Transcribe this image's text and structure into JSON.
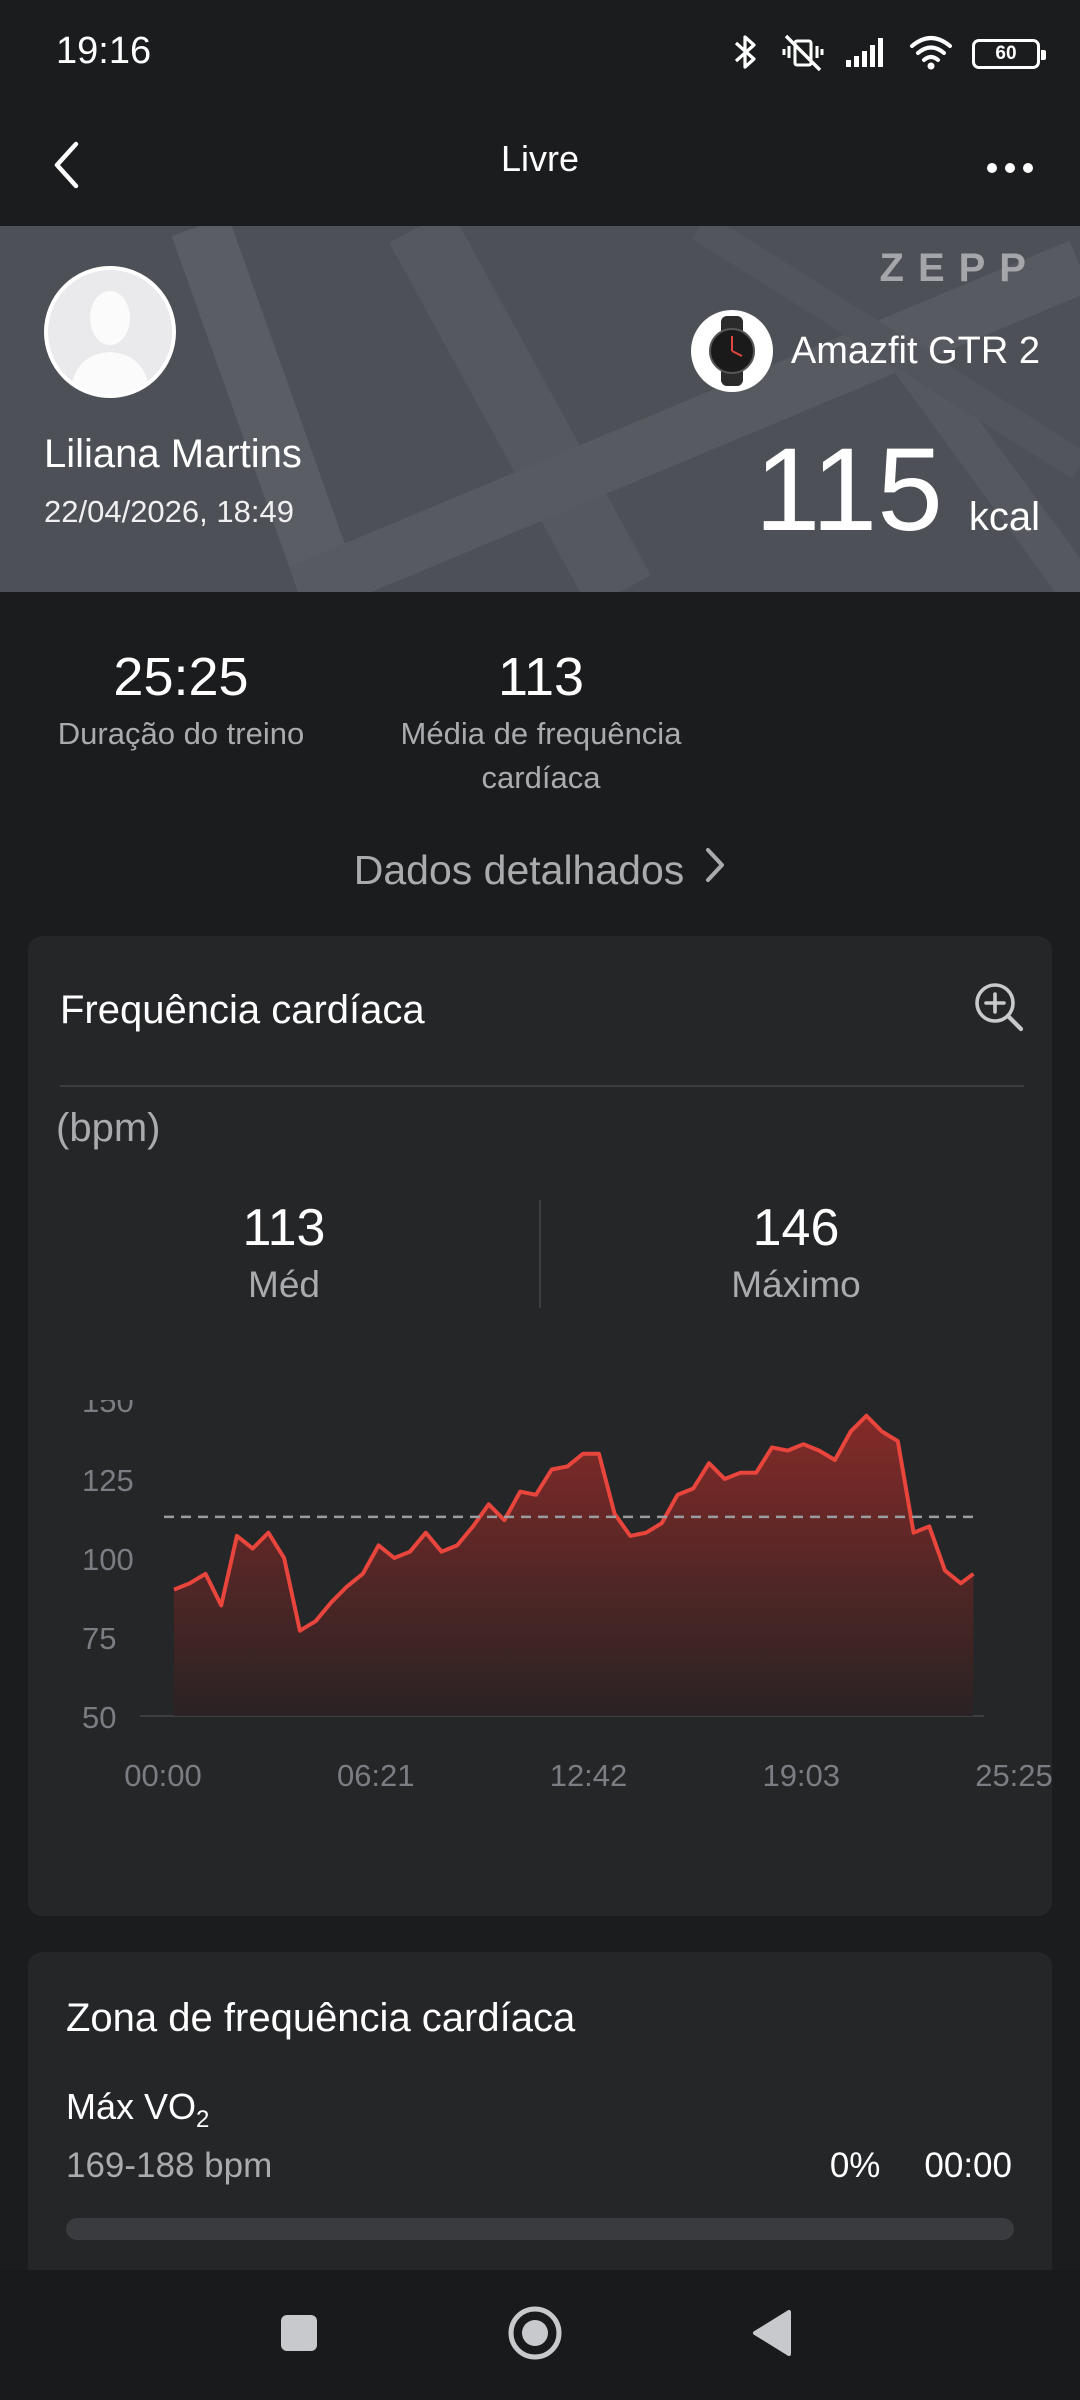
{
  "status_bar": {
    "time": "19:16",
    "battery": "60"
  },
  "header": {
    "title": "Livre"
  },
  "banner": {
    "brand_logo": "ZEPP",
    "user_name": "Liliana Martins",
    "date": "22/04/2026, 18:49",
    "device_name": "Amazfit GTR 2",
    "calories_value": "115",
    "calories_unit": "kcal"
  },
  "stats": {
    "duration_value": "25:25",
    "duration_label": "Duração do treino",
    "avg_hr_value": "113",
    "avg_hr_label_line1": "Média de frequência",
    "avg_hr_label_line2": "cardíaca"
  },
  "details_link": "Dados detalhados",
  "heart_rate_card": {
    "title": "Frequência cardíaca",
    "unit": "(bpm)",
    "avg_value": "113",
    "avg_label": "Méd",
    "max_value": "146",
    "max_label": "Máximo"
  },
  "chart_data": {
    "type": "area",
    "x_tick_labels": [
      "00:00",
      "06:21",
      "12:42",
      "19:03",
      "25:25"
    ],
    "y_tick_labels": [
      "150",
      "125",
      "100",
      "75",
      "50"
    ],
    "xlim": [
      0,
      25.42
    ],
    "ylim": [
      50,
      150
    ],
    "reference_line": 113,
    "series": [
      {
        "x": [
          0,
          0.5,
          1.0,
          1.5,
          2.0,
          2.5,
          3.0,
          3.5,
          4.0,
          4.5,
          5.0,
          5.5,
          6.0,
          6.5,
          7.0,
          7.5,
          8.0,
          8.5,
          9.0,
          9.5,
          10.0,
          10.5,
          11.0,
          11.5,
          12.0,
          12.5,
          13.0,
          13.5,
          14.0,
          14.5,
          15.0,
          15.5,
          16.0,
          16.5,
          17.0,
          17.5,
          18.0,
          18.5,
          19.0,
          19.5,
          20.0,
          20.5,
          21.0,
          21.5,
          22.0,
          22.5,
          23.0,
          23.5,
          24.0,
          24.5,
          25.0,
          25.4
        ],
        "values": [
          90,
          92,
          95,
          85,
          107,
          103,
          108,
          100,
          77,
          80,
          86,
          91,
          95,
          104,
          100,
          102,
          108,
          102,
          104,
          110,
          117,
          112,
          121,
          120,
          128,
          129,
          133,
          133,
          114,
          107,
          108,
          111,
          120,
          122,
          130,
          125,
          127,
          127,
          135,
          134,
          136,
          134,
          131,
          140,
          145,
          140,
          137,
          108,
          110,
          96,
          92,
          95
        ]
      }
    ],
    "colors": {
      "line": "#e8453c",
      "fill_top": "#8a2b28",
      "fill_bottom": "#2a2223"
    }
  },
  "zone_card": {
    "title": "Zona de frequência cardíaca",
    "zone_name": "Máx VO",
    "zone_name_sub": "2",
    "zone_range": "169-188 bpm",
    "zone_percent": "0%",
    "zone_time": "00:00",
    "zone_fraction": 0
  },
  "icons": [
    "bluetooth-icon",
    "mute-vibrate-icon",
    "signal-icon",
    "wifi-icon",
    "battery-icon",
    "back-arrow-icon",
    "more-icon",
    "zoom-in-icon",
    "chevron-right-icon",
    "watch-icon",
    "nav-recents-icon",
    "nav-home-icon",
    "nav-back-icon"
  ]
}
